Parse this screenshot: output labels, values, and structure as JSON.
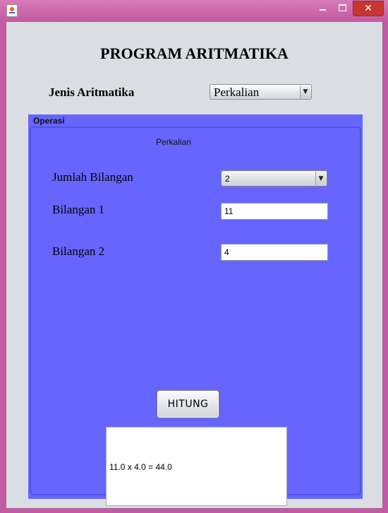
{
  "window": {
    "controls": {
      "minimize": "minimize-icon",
      "maximize": "maximize-icon",
      "close": "✕"
    }
  },
  "header": {
    "title": "PROGRAM ARITMATIKA",
    "jenis_label": "Jenis Aritmatika",
    "jenis_selected": "Perkalian"
  },
  "operasi": {
    "panel_title": "Operasi",
    "mode_label": "Perkalian",
    "jumlah_label": "Jumlah Bilangan",
    "jumlah_selected": "2",
    "bilangan1_label": "Bilangan 1",
    "bilangan1_value": "11",
    "bilangan2_label": "Bilangan 2",
    "bilangan2_value": "4",
    "hitung_label": "HITUNG",
    "result_text": "11.0 x 4.0 = 44.0"
  },
  "colors": {
    "panel_background": "#6666ff",
    "client_background": "#dadde2",
    "frame_accent": "#c45aa3",
    "close_button": "#c7372f"
  }
}
